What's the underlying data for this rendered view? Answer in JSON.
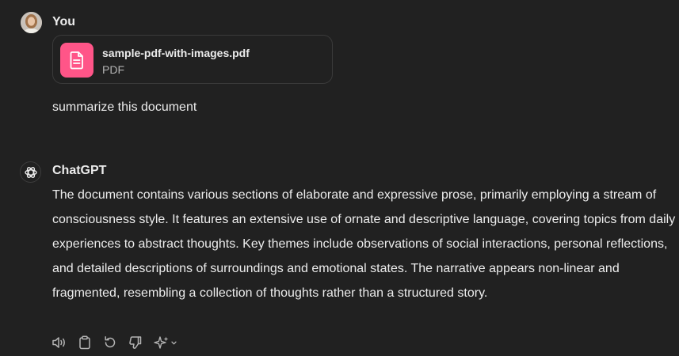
{
  "user": {
    "name": "You",
    "attachment": {
      "file_name": "sample-pdf-with-images.pdf",
      "file_type": "PDF",
      "icon": "document-icon"
    },
    "message": "summarize this document"
  },
  "assistant": {
    "name": "ChatGPT",
    "icon": "openai-logo-icon",
    "message": "The document contains various sections of elaborate and expressive prose, primarily employing a stream of consciousness style. It features an extensive use of ornate and descriptive language, covering topics from daily experiences to abstract thoughts. Key themes include observations of social interactions, personal reflections, and detailed descriptions of surroundings and emotional states. The narrative appears non-linear and fragmented, resembling a collection of thoughts rather than a structured story."
  },
  "actions": [
    {
      "name": "read-aloud",
      "icon": "speaker-icon"
    },
    {
      "name": "copy",
      "icon": "clipboard-icon"
    },
    {
      "name": "regenerate",
      "icon": "refresh-icon"
    },
    {
      "name": "bad-response",
      "icon": "thumbs-down-icon"
    },
    {
      "name": "change-model",
      "icon": "sparkle-icon"
    }
  ],
  "colors": {
    "background": "#212121",
    "text": "#ececec",
    "muted": "#b4b4b4",
    "file_tile": "#ff5588",
    "border": "#3a3a3a"
  }
}
